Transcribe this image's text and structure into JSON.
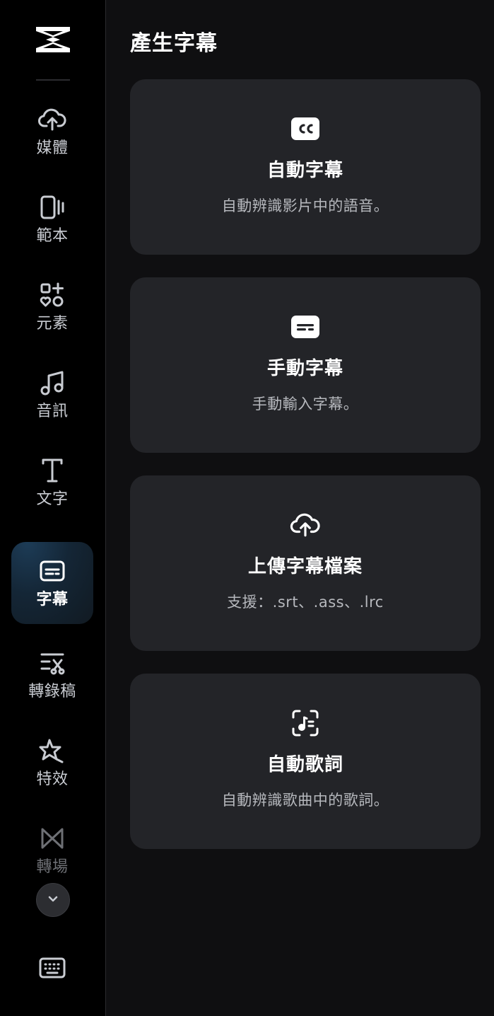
{
  "sidebar": {
    "items": [
      {
        "label": "媒體",
        "icon": "cloud-upload-icon"
      },
      {
        "label": "範本",
        "icon": "template-icon"
      },
      {
        "label": "元素",
        "icon": "elements-icon"
      },
      {
        "label": "音訊",
        "icon": "music-note-icon"
      },
      {
        "label": "文字",
        "icon": "text-icon"
      },
      {
        "label": "字幕",
        "icon": "subtitles-icon",
        "active": true
      },
      {
        "label": "轉錄稿",
        "icon": "transcript-icon"
      },
      {
        "label": "特效",
        "icon": "effects-star-icon"
      },
      {
        "label": "轉場",
        "icon": "transition-icon"
      }
    ],
    "more_icon": "chevron-down-icon",
    "keyboard_icon": "keyboard-icon"
  },
  "main": {
    "title": "產生字幕",
    "cards": [
      {
        "title": "自動字幕",
        "description": "自動辨識影片中的語音。",
        "icon": "cc-icon"
      },
      {
        "title": "手動字幕",
        "description": "手動輸入字幕。",
        "icon": "subtitle-box-icon"
      },
      {
        "title": "上傳字幕檔案",
        "description": "支援：.srt、.ass、.lrc",
        "icon": "cloud-upload-icon"
      },
      {
        "title": "自動歌詞",
        "description": "自動辨識歌曲中的歌詞。",
        "icon": "lyrics-scan-icon"
      }
    ]
  },
  "colors": {
    "sidebar_bg": "#000000",
    "main_bg": "#0f0f11",
    "card_bg": "#232428",
    "active_item_bg": "#1d3c57"
  }
}
